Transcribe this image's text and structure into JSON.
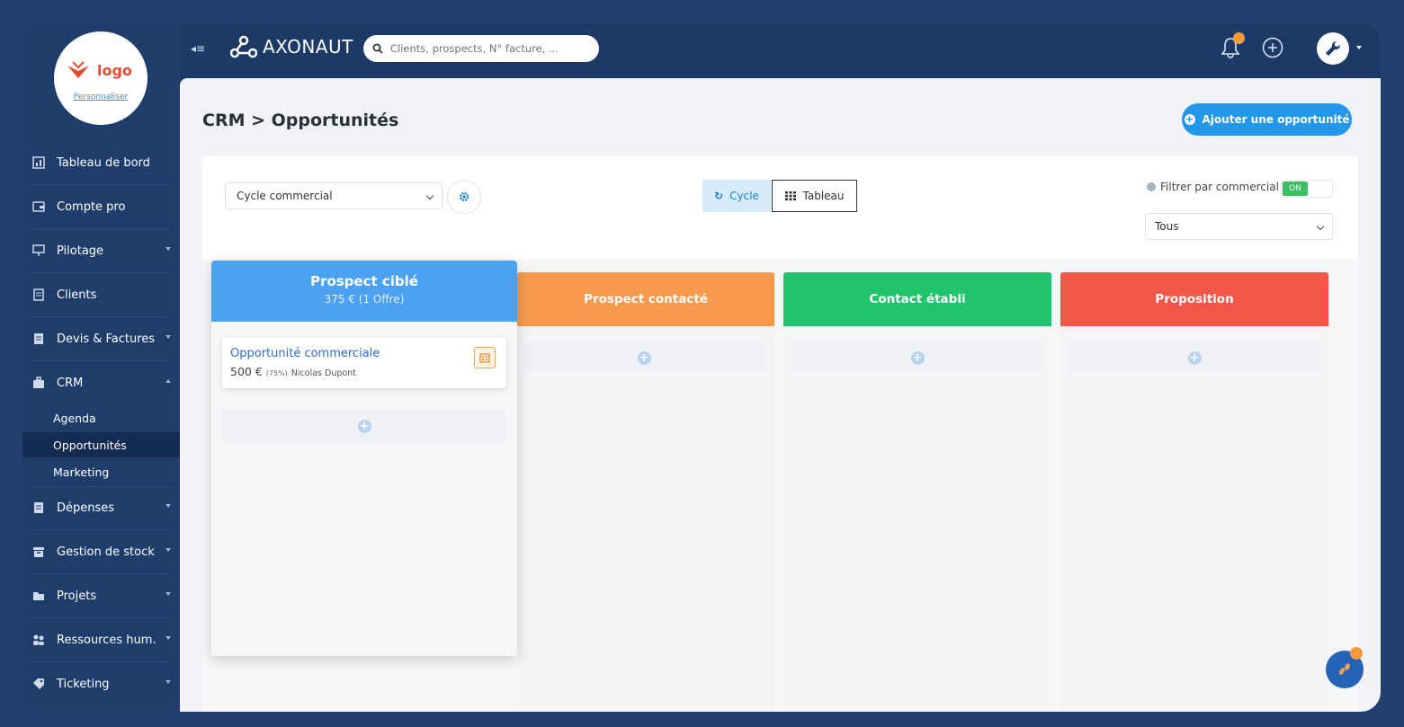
{
  "sidebar": {
    "logo_text": "logo",
    "logo_link": "Personnaliser",
    "items": [
      {
        "label": "Tableau de bord"
      },
      {
        "label": "Compte pro"
      },
      {
        "label": "Pilotage"
      },
      {
        "label": "Clients"
      },
      {
        "label": "Devis & Factures"
      },
      {
        "label": "CRM"
      },
      {
        "label": "Dépenses"
      },
      {
        "label": "Gestion de stock"
      },
      {
        "label": "Projets"
      },
      {
        "label": "Ressources hum."
      },
      {
        "label": "Ticketing"
      }
    ],
    "crm_sub": [
      {
        "label": "Agenda"
      },
      {
        "label": "Opportunités"
      },
      {
        "label": "Marketing"
      }
    ]
  },
  "topbar": {
    "brand": "AXONAUT",
    "search_placeholder": "Clients, prospects, N° facture, ..."
  },
  "page": {
    "title": "CRM > Opportunités",
    "add_button": "Ajouter une opportunité"
  },
  "toolbar": {
    "cycle_select": "Cycle commercial",
    "view_cycle": "Cycle",
    "view_table": "Tableau",
    "filter_label": "Filtrer par commercial",
    "switch_state": "ON",
    "salesperson_select": "Tous"
  },
  "columns": [
    {
      "title": "Prospect ciblé",
      "summary": "375 € (1 Offre)",
      "color": "#4ba1f2"
    },
    {
      "title": "Prospect contacté",
      "color": "#f79a4e"
    },
    {
      "title": "Contact établi",
      "color": "#1fc46d"
    },
    {
      "title": "Proposition",
      "color": "#f2574a"
    }
  ],
  "card": {
    "title": "Opportunité commerciale",
    "amount": "500 €",
    "probability": "(75%)",
    "owner": "Nicolas Dupont"
  },
  "colors": {
    "accent": "#2397ea",
    "sidebar_bg": "#1f3d6b",
    "active_item_bg": "#142c52"
  }
}
